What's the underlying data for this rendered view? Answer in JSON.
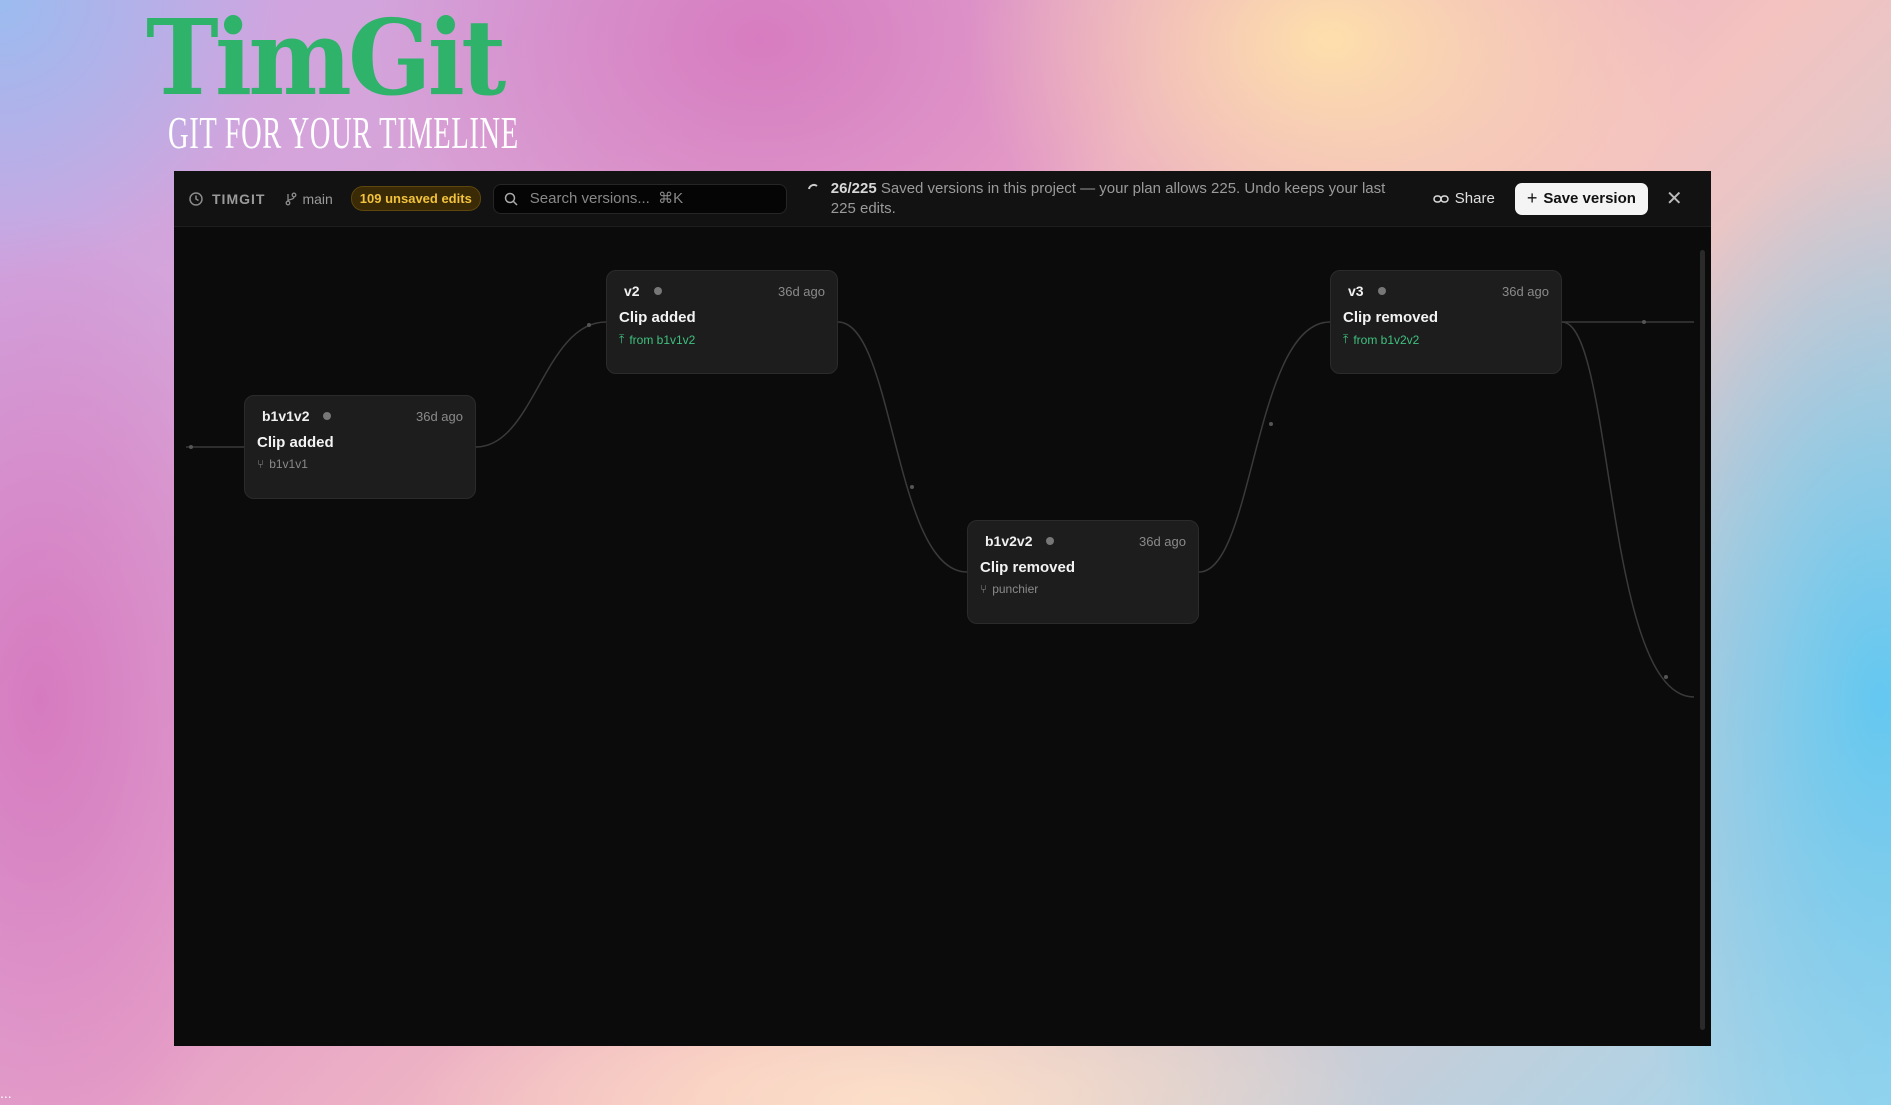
{
  "brand": {
    "logo": "TimGit",
    "tagline": "GIT FOR YOUR TIMELINE"
  },
  "topbar": {
    "app_name": "TIMGIT",
    "branch": "main",
    "unsaved_badge": "109 unsaved edits",
    "search_placeholder": "Search versions...  ⌘K",
    "saved_count": "26/225",
    "saved_text": "Saved versions in this project — your plan allows 225. Undo keeps your last 225 edits.",
    "share_label": "Share",
    "save_label": "Save version"
  },
  "nodes": [
    {
      "name": "b1v1v2",
      "time": "36d ago",
      "message": "Clip added",
      "sub": "b1v1v1",
      "sub_type": "branch"
    },
    {
      "name": "v2",
      "time": "36d ago",
      "message": "Clip added",
      "sub": "from b1v1v2",
      "sub_type": "merge"
    },
    {
      "name": "b1v2v2",
      "time": "36d ago",
      "message": "Clip removed",
      "sub": "punchier",
      "sub_type": "branch"
    },
    {
      "name": "v3",
      "time": "36d ago",
      "message": "Clip removed",
      "sub": "from b1v2v2",
      "sub_type": "merge"
    }
  ],
  "colors": {
    "logo": "#2fb36b",
    "badge_text": "#f3c33d",
    "merge_green": "#3fc17f",
    "canvas": "#0b0b0b"
  },
  "footer": {
    "ellipsis": "..."
  }
}
